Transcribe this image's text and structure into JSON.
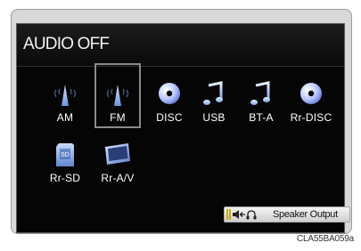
{
  "header": {
    "title": "AUDIO OFF"
  },
  "sources": [
    {
      "label": "AM",
      "icon": "radio-tower-icon"
    },
    {
      "label": "FM",
      "icon": "radio-tower-icon",
      "selected": true
    },
    {
      "label": "DISC",
      "icon": "disc-icon"
    },
    {
      "label": "USB",
      "icon": "music-note-icon"
    },
    {
      "label": "BT-A",
      "icon": "music-note-icon"
    },
    {
      "label": "Rr-DISC",
      "icon": "disc-icon"
    },
    {
      "label": "Rr-SD",
      "icon": "sd-card-icon"
    },
    {
      "label": "Rr-A/V",
      "icon": "monitor-icon"
    }
  ],
  "footer": {
    "speaker_output_label": "Speaker Output"
  },
  "figure_code": "CLA55BA059a",
  "colors": {
    "screen_bg": "#050505",
    "icon_blue": "#8fb6ff",
    "text": "#ffffff"
  }
}
